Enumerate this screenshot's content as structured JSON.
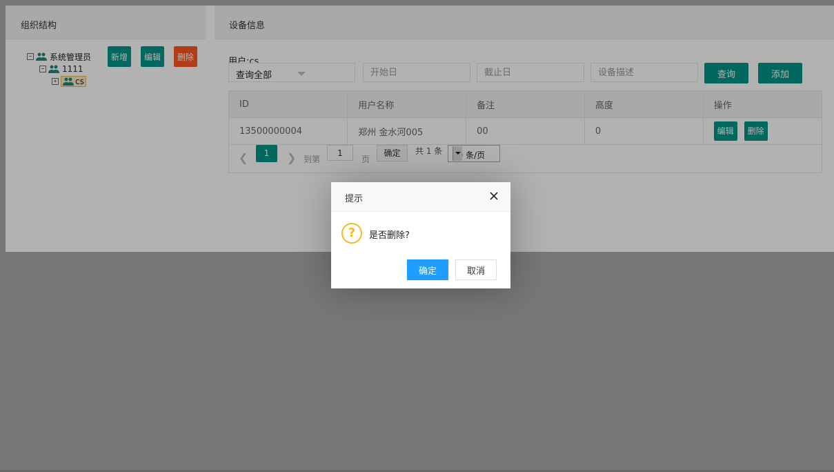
{
  "left_panel": {
    "title": "组织结构",
    "tree": [
      {
        "toggle": "−",
        "label": "系统管理员"
      },
      {
        "toggle": "−",
        "label": "1111"
      },
      {
        "toggle": "+",
        "label": "cs",
        "selected": true
      }
    ],
    "buttons": {
      "add": "新增",
      "edit": "编辑",
      "delete": "删除"
    }
  },
  "right_panel": {
    "title": "设备信息",
    "user_label": "用户:cs",
    "filter": {
      "select_value": "查询全部",
      "start_placeholder": "开始日",
      "end_placeholder": "截止日",
      "desc_placeholder": "设备描述",
      "query_button": "查询",
      "add_button": "添加"
    },
    "table": {
      "headers": [
        "ID",
        "用户名称",
        "备注",
        "高度",
        "操作"
      ],
      "rows": [
        {
          "id": "13500000004",
          "name": "郑州 金水河005",
          "remark": "00",
          "height": "0",
          "edit": "编辑",
          "delete": "删除"
        }
      ]
    },
    "pager": {
      "current_page": "1",
      "goto_label": "到第",
      "goto_value": "1",
      "page_unit": "页",
      "confirm": "确定",
      "total": "共 1 条",
      "page_size": "10 条/页"
    }
  },
  "dialog": {
    "title": "提示",
    "message": "是否删除?",
    "ok": "确定",
    "cancel": "取消"
  },
  "colors": {
    "primary_green": "#009688",
    "danger_orange": "#ff5722",
    "dialog_blue": "#1e9fff",
    "warning_yellow": "#f7b824"
  },
  "icons": {
    "tree_node": "people-group-icon",
    "close": "close-icon",
    "question": "question-icon",
    "dropdown": "chevron-down-icon"
  }
}
